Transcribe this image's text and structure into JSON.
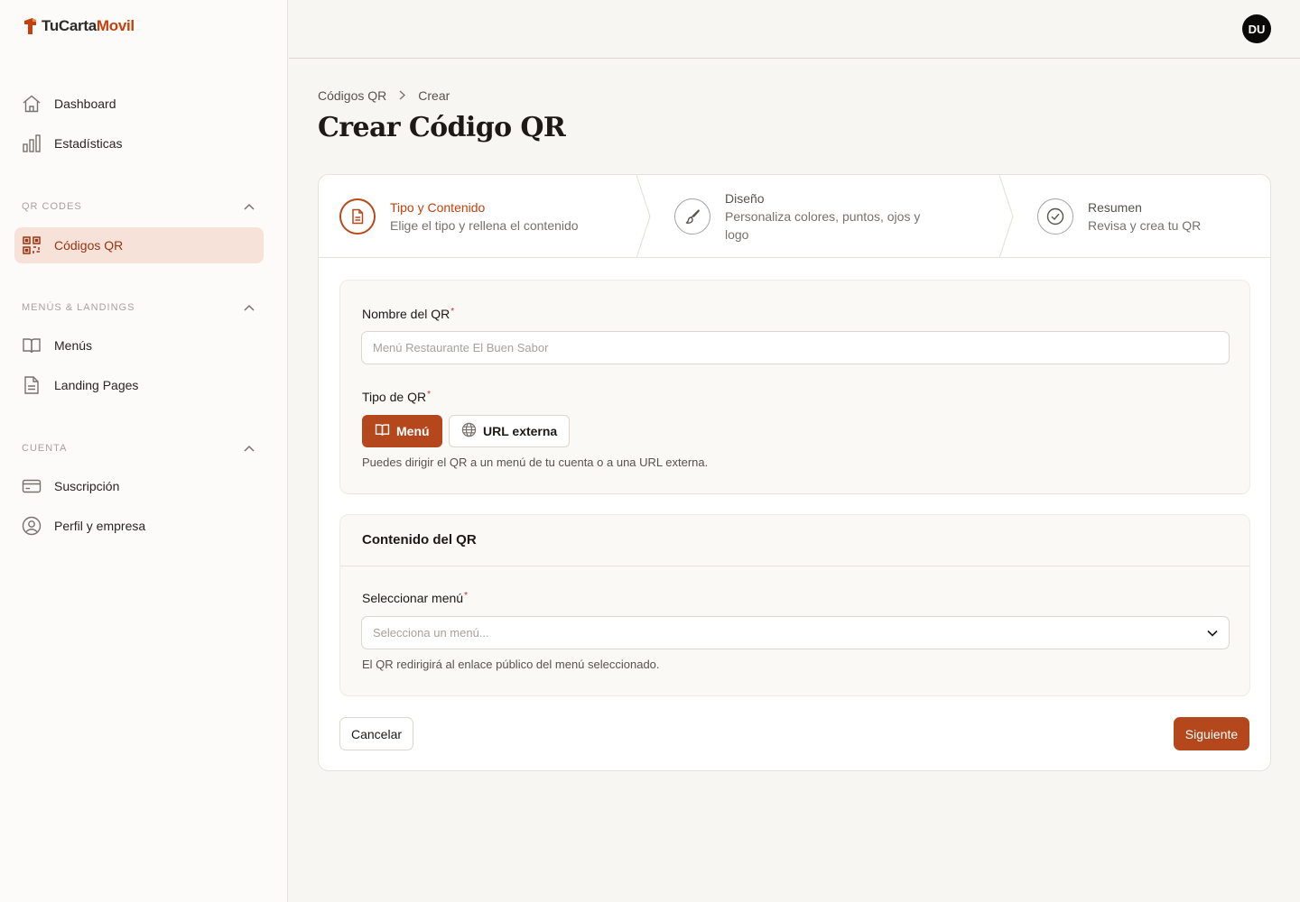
{
  "brand": {
    "name_part1": "TuCarta",
    "name_part2": "Movil",
    "accent": "#c2410c"
  },
  "header": {
    "avatar_initials": "DU"
  },
  "sidebar": {
    "top_items": [
      {
        "label": "Dashboard",
        "icon": "home-icon"
      },
      {
        "label": "Estadísticas",
        "icon": "bar-chart-icon"
      }
    ],
    "sections": [
      {
        "title": "QR CODES",
        "items": [
          {
            "label": "Códigos QR",
            "icon": "qr-code-icon",
            "active": true
          }
        ]
      },
      {
        "title": "MENÚS & LANDINGS",
        "items": [
          {
            "label": "Menús",
            "icon": "book-icon"
          },
          {
            "label": "Landing Pages",
            "icon": "file-icon"
          }
        ]
      },
      {
        "title": "CUENTA",
        "items": [
          {
            "label": "Suscripción",
            "icon": "credit-card-icon"
          },
          {
            "label": "Perfil y empresa",
            "icon": "user-circle-icon"
          }
        ]
      }
    ]
  },
  "breadcrumb": {
    "parent": "Códigos QR",
    "current": "Crear"
  },
  "page": {
    "title": "Crear Código QR"
  },
  "stepper": [
    {
      "title": "Tipo y Contenido",
      "desc": "Elige el tipo y rellena el contenido",
      "icon": "document-icon",
      "active": true
    },
    {
      "title": "Diseño",
      "desc_line1": "Personaliza colores, puntos, ojos y",
      "desc_line2": "logo",
      "icon": "brush-icon",
      "active": false
    },
    {
      "title": "Resumen",
      "desc": "Revisa y crea tu QR",
      "icon": "check-circle-icon",
      "active": false
    }
  ],
  "form": {
    "name_label": "Nombre del QR",
    "name_placeholder": "Menú Restaurante El Buen Sabor",
    "type_label": "Tipo de QR",
    "type_options": [
      {
        "label": "Menú",
        "selected": true
      },
      {
        "label": "URL externa",
        "selected": false
      }
    ],
    "type_hint": "Puedes dirigir el QR a un menú de tu cuenta o a una URL externa.",
    "content_title": "Contenido del QR",
    "menu_label": "Seleccionar menú",
    "menu_placeholder": "Selecciona un menú...",
    "menu_hint": "El QR redirigirá al enlace público del menú seleccionado.",
    "required_mark": "*"
  },
  "actions": {
    "cancel": "Cancelar",
    "next": "Siguiente"
  }
}
